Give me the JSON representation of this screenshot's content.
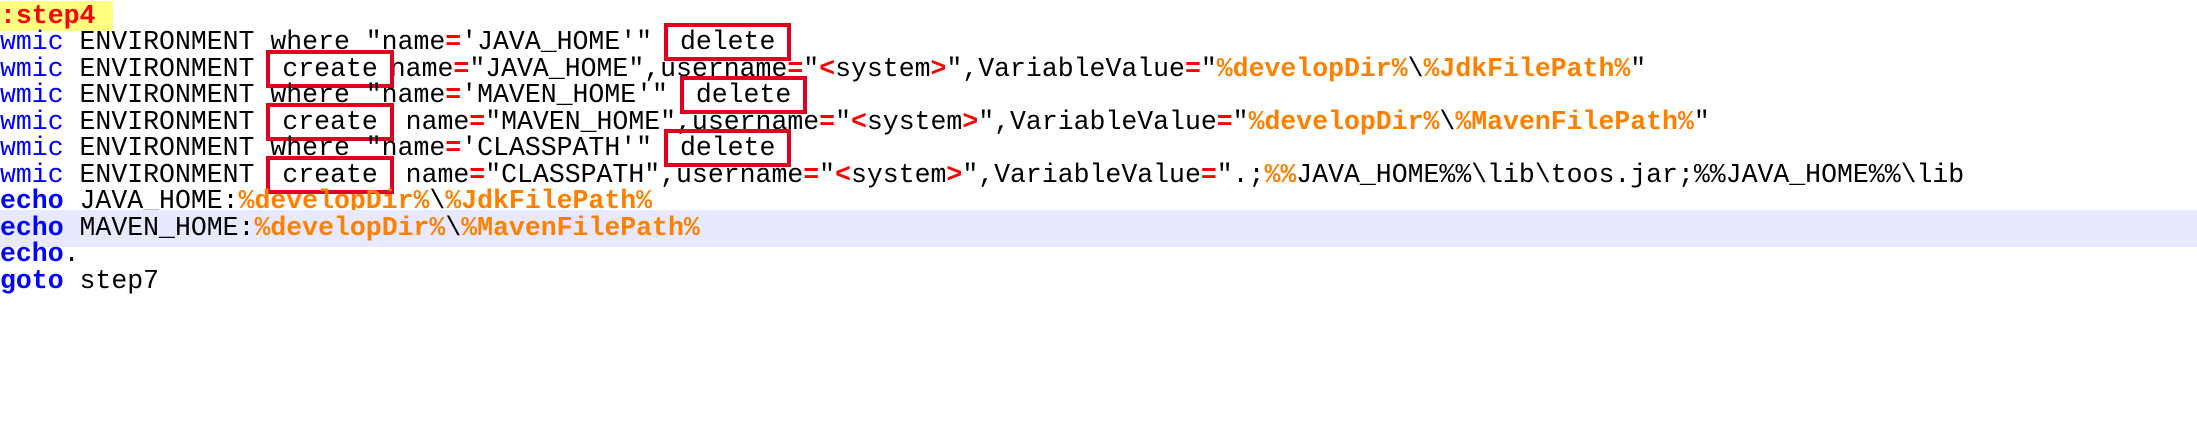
{
  "editor": {
    "current_line": 8,
    "lines": [
      [
        [
          "label",
          ":step4"
        ]
      ],
      [
        [
          "cmd",
          "wmic"
        ],
        [
          "txt",
          " ENVIRONMENT where \"name"
        ],
        [
          "op",
          "="
        ],
        [
          "txt",
          "'JAVA_HOME'\" "
        ],
        [
          "txt",
          "delete",
          "box"
        ]
      ],
      [
        [
          "cmd",
          "wmic"
        ],
        [
          "txt",
          " ENVIRONMENT "
        ],
        [
          "txt",
          "create",
          "box"
        ],
        [
          "txt",
          "name"
        ],
        [
          "op",
          "="
        ],
        [
          "txt",
          "\"JAVA_HOME\",username"
        ],
        [
          "op",
          "="
        ],
        [
          "txt",
          "\""
        ],
        [
          "op",
          "<"
        ],
        [
          "txt",
          "system"
        ],
        [
          "op",
          ">"
        ],
        [
          "txt",
          "\",VariableValue"
        ],
        [
          "op",
          "="
        ],
        [
          "txt",
          "\""
        ],
        [
          "var",
          "%developDir%"
        ],
        [
          "txt",
          "\\"
        ],
        [
          "var",
          "%JdkFilePath%"
        ],
        [
          "txt",
          "\""
        ]
      ],
      [
        [
          "cmd",
          "wmic"
        ],
        [
          "txt",
          " ENVIRONMENT where \"name"
        ],
        [
          "op",
          "="
        ],
        [
          "txt",
          "'MAVEN_HOME'\" "
        ],
        [
          "txt",
          "delete",
          "box"
        ]
      ],
      [
        [
          "cmd",
          "wmic"
        ],
        [
          "txt",
          " ENVIRONMENT "
        ],
        [
          "txt",
          "create",
          "box"
        ],
        [
          "txt",
          " name"
        ],
        [
          "op",
          "="
        ],
        [
          "txt",
          "\"MAVEN_HOME\",username"
        ],
        [
          "op",
          "="
        ],
        [
          "txt",
          "\""
        ],
        [
          "op",
          "<"
        ],
        [
          "txt",
          "system"
        ],
        [
          "op",
          ">"
        ],
        [
          "txt",
          "\",VariableValue"
        ],
        [
          "op",
          "="
        ],
        [
          "txt",
          "\""
        ],
        [
          "var",
          "%developDir%"
        ],
        [
          "txt",
          "\\"
        ],
        [
          "var",
          "%MavenFilePath%"
        ],
        [
          "txt",
          "\""
        ]
      ],
      [
        [
          "cmd",
          "wmic"
        ],
        [
          "txt",
          " ENVIRONMENT where \"name"
        ],
        [
          "op",
          "="
        ],
        [
          "txt",
          "'CLASSPATH'\" "
        ],
        [
          "txt",
          "delete",
          "box"
        ]
      ],
      [
        [
          "cmd",
          "wmic"
        ],
        [
          "txt",
          " ENVIRONMENT "
        ],
        [
          "txt",
          "create",
          "box"
        ],
        [
          "txt",
          " name"
        ],
        [
          "op",
          "="
        ],
        [
          "txt",
          "\"CLASSPATH\",username"
        ],
        [
          "op",
          "="
        ],
        [
          "txt",
          "\""
        ],
        [
          "op",
          "<"
        ],
        [
          "txt",
          "system"
        ],
        [
          "op",
          ">"
        ],
        [
          "txt",
          "\",VariableValue"
        ],
        [
          "op",
          "="
        ],
        [
          "txt",
          "\".;"
        ],
        [
          "var",
          "%%"
        ],
        [
          "txt",
          "JAVA_HOME%%\\lib\\toos.jar;%%JAVA_HOME%%\\lib"
        ]
      ],
      [
        [
          "kw",
          "echo"
        ],
        [
          "txt",
          " JAVA_HOME:"
        ],
        [
          "var",
          "%developDir%"
        ],
        [
          "txt",
          "\\"
        ],
        [
          "var",
          "%JdkFilePath%"
        ]
      ],
      [
        [
          "kw",
          "echo"
        ],
        [
          "txt",
          " MAVEN_HOME:"
        ],
        [
          "var",
          "%developDir%"
        ],
        [
          "txt",
          "\\"
        ],
        [
          "var",
          "%MavenFilePath%"
        ]
      ],
      [
        [
          "kw",
          "echo"
        ],
        [
          "txt",
          "."
        ]
      ],
      [
        [
          "kw",
          "goto"
        ],
        [
          "txt",
          " step7"
        ]
      ]
    ]
  }
}
